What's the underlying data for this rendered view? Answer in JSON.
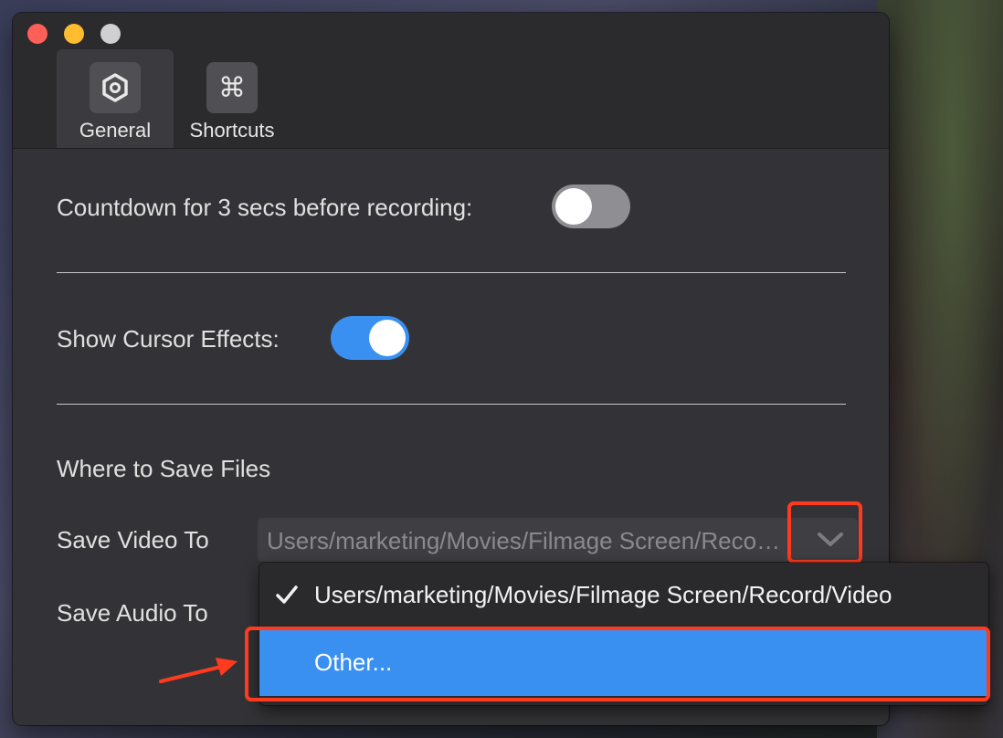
{
  "tabs": [
    {
      "label": "General",
      "icon": "gear-hex-icon",
      "active": true
    },
    {
      "label": "Shortcuts",
      "icon": "command-icon",
      "active": false
    }
  ],
  "settings": {
    "countdown_label": "Countdown for 3 secs before recording:",
    "countdown_enabled": false,
    "cursor_label": "Show Cursor Effects:",
    "cursor_enabled": true,
    "save_section_title": "Where to Save Files",
    "save_video_label": "Save Video To",
    "save_video_path": "Users/marketing/Movies/Filmage Screen/Record/Video",
    "save_audio_label": "Save Audio To"
  },
  "menu": {
    "items": [
      {
        "label": "Users/marketing/Movies/Filmage Screen/Record/Video",
        "checked": true
      },
      {
        "label": "Other...",
        "checked": false,
        "highlighted": true
      }
    ]
  },
  "colors": {
    "accent": "#3a90f0",
    "annotation": "#ff3b1f",
    "toggle_off": "#8e8e93",
    "toggle_on": "#3a90f0"
  }
}
